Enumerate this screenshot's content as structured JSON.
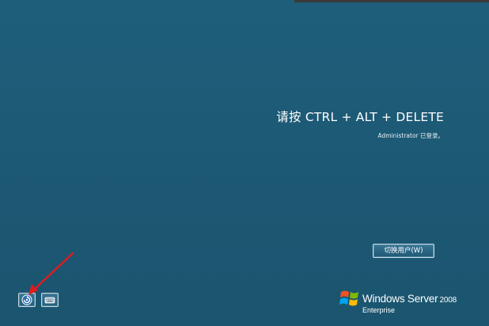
{
  "login": {
    "prompt": "请按 CTRL + ALT + DELETE",
    "logged_in_note": "Administrator 已登录。",
    "switch_user_label": "切换用户(W)"
  },
  "toolbar": {
    "ease_of_access_icon": "ease-of-access-icon",
    "keyboard_icon": "keyboard-icon"
  },
  "annotation": {
    "arrow_color": "#e01b1b"
  },
  "brand": {
    "product": "Windows Server",
    "version": "2008",
    "edition": "Enterprise",
    "logo_icon": "windows-flag-icon"
  },
  "colors": {
    "background": "#1d5a77",
    "text": "#ffffff"
  }
}
